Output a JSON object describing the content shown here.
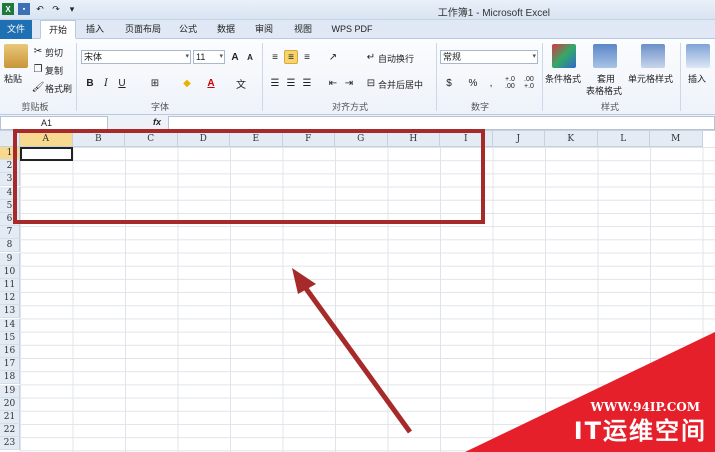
{
  "window": {
    "title": "工作簿1 - Microsoft Excel"
  },
  "quick_access": {
    "undo": "↶",
    "redo": "↷"
  },
  "tabs": [
    {
      "label": "文件"
    },
    {
      "label": "开始"
    },
    {
      "label": "插入"
    },
    {
      "label": "页面布局"
    },
    {
      "label": "公式"
    },
    {
      "label": "数据"
    },
    {
      "label": "审阅"
    },
    {
      "label": "视图"
    },
    {
      "label": "WPS PDF"
    }
  ],
  "ribbon": {
    "clipboard": {
      "paste": "粘贴",
      "cut": "剪切",
      "copy": "复制",
      "format_painter": "格式刷",
      "group": "剪贴板"
    },
    "font": {
      "name": "宋体",
      "size": "11",
      "bold": "B",
      "italic": "I",
      "underline": "U",
      "group": "字体"
    },
    "alignment": {
      "wrap": "自动换行",
      "merge": "合并后居中",
      "group": "对齐方式"
    },
    "number": {
      "format": "常规",
      "percent": "%",
      "comma": ",",
      "inc_dec": "+.0 .00",
      "dec_dec": ".00 +.0",
      "group": "数字"
    },
    "styles": {
      "conditional": "条件格式",
      "table_line1": "套用",
      "table_line2": "表格格式",
      "cell_styles": "单元格样式",
      "group": "样式"
    },
    "cells": {
      "insert": "插入"
    }
  },
  "formula_bar": {
    "name_box": "A1",
    "fx": "fx",
    "value": ""
  },
  "grid": {
    "columns": [
      "A",
      "B",
      "C",
      "D",
      "E",
      "F",
      "G",
      "H",
      "I",
      "J",
      "K",
      "L",
      "M"
    ],
    "rows": [
      "1",
      "2",
      "3",
      "4",
      "5",
      "6",
      "7",
      "8",
      "9",
      "10",
      "11",
      "12",
      "13",
      "14",
      "15",
      "16",
      "17",
      "18",
      "19",
      "20",
      "21",
      "22",
      "23"
    ],
    "selected_column": "A",
    "selected_row": "1"
  },
  "watermark": {
    "url": "WWW.94IP.COM",
    "name": "IT运维空间"
  },
  "colors": {
    "annotation": "#a62a2a",
    "file_tab": "#1f6fb3",
    "watermark": "#e6202b"
  }
}
